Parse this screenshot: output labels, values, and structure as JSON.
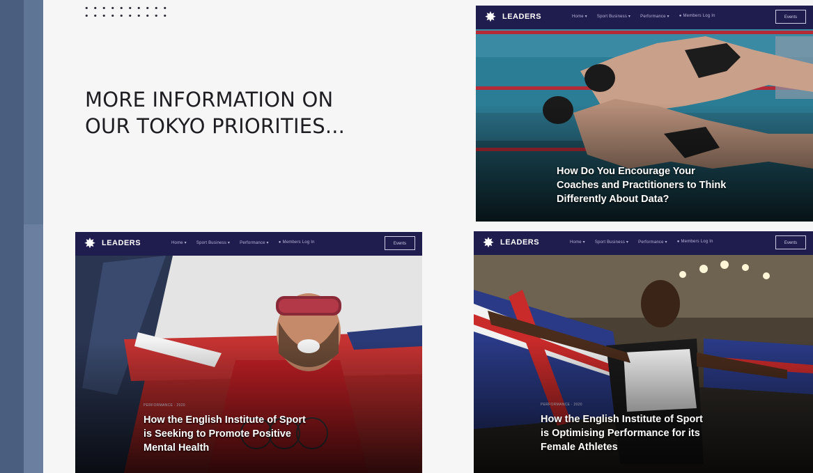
{
  "slide": {
    "headline": "MORE INFORMATION ON\nOUR TOKYO PRIORITIES..."
  },
  "site": {
    "logo_text": "LEADERS",
    "nav_items": [
      "Home ▾",
      "Sport Business ▾",
      "Performance ▾",
      "● Members Log In"
    ],
    "nav_button": "Events"
  },
  "cards": [
    {
      "id": "swim",
      "meta": "",
      "title": "How Do You Encourage Your\nCoaches and Practitioners to Think\nDifferently About Data?"
    },
    {
      "id": "ski",
      "meta": "PERFORMANCE · 2020",
      "title": "How the English Institute of Sport\nis Seeking to Promote Positive\nMental Health"
    },
    {
      "id": "track",
      "meta": "PERFORMANCE · 2020",
      "title": "How the English Institute of Sport\nis Optimising Performance for its\nFemale Athletes"
    }
  ],
  "colors": {
    "nav_bg": "#1f1c4e",
    "side_bar": "#4a5f80",
    "headline": "#1d1d22"
  }
}
